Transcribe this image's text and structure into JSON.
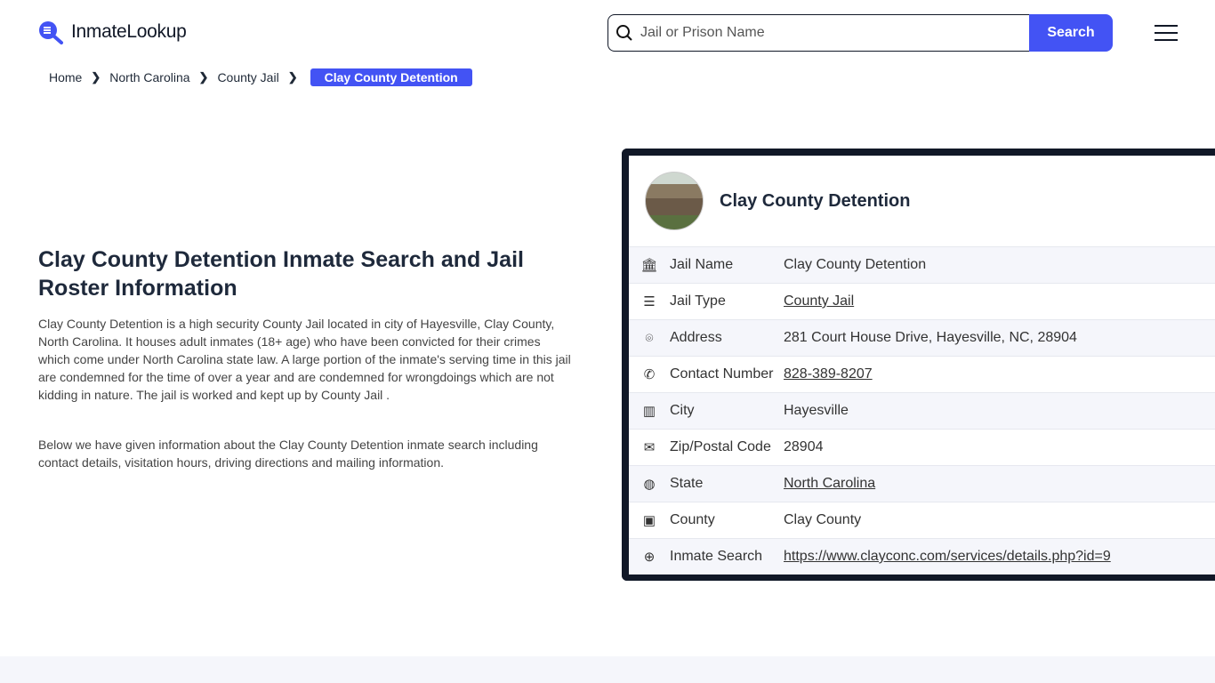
{
  "header": {
    "logo_text": "InmateLookup",
    "search_placeholder": "Jail or Prison Name",
    "search_button": "Search"
  },
  "breadcrumb": [
    "Home",
    "North Carolina",
    "County Jail",
    "Clay County Detention"
  ],
  "main": {
    "title": "Clay County Detention Inmate Search and Jail Roster Information",
    "para1": "Clay County Detention is a high security County Jail located in city of Hayesville, Clay County, North Carolina. It houses adult inmates (18+ age) who have been convicted for their crimes which come under North Carolina state law. A large portion of the inmate's serving time in this jail are condemned for the time of over a year and are condemned for wrongdoings which are not kidding in nature. The jail is worked and kept up by County Jail .",
    "para2": "Below we have given information about the Clay County Detention inmate search including contact details, visitation hours, driving directions and mailing information."
  },
  "card": {
    "title": "Clay County Detention",
    "rows": [
      {
        "icon": "bank-icon",
        "label": "Jail Name",
        "value": "Clay County Detention",
        "link": false
      },
      {
        "icon": "list-icon",
        "label": "Jail Type",
        "value": "County Jail",
        "link": true
      },
      {
        "icon": "map-pin-icon",
        "label": "Address",
        "value": "281 Court House Drive, Hayesville, NC, 28904",
        "link": false
      },
      {
        "icon": "phone-icon",
        "label": "Contact Number",
        "value": "828-389-8207",
        "link": true
      },
      {
        "icon": "map-icon",
        "label": "City",
        "value": "Hayesville",
        "link": false
      },
      {
        "icon": "mail-icon",
        "label": "Zip/Postal Code",
        "value": "28904",
        "link": false
      },
      {
        "icon": "globe-icon",
        "label": "State",
        "value": "North Carolina",
        "link": true
      },
      {
        "icon": "county-icon",
        "label": "County",
        "value": "Clay County",
        "link": false
      },
      {
        "icon": "web-icon",
        "label": "Inmate Search",
        "value": "https://www.clayconc.com/services/details.php?id=9",
        "link": true
      }
    ]
  },
  "colors": {
    "accent": "#4353f4",
    "card_border": "#111827"
  }
}
